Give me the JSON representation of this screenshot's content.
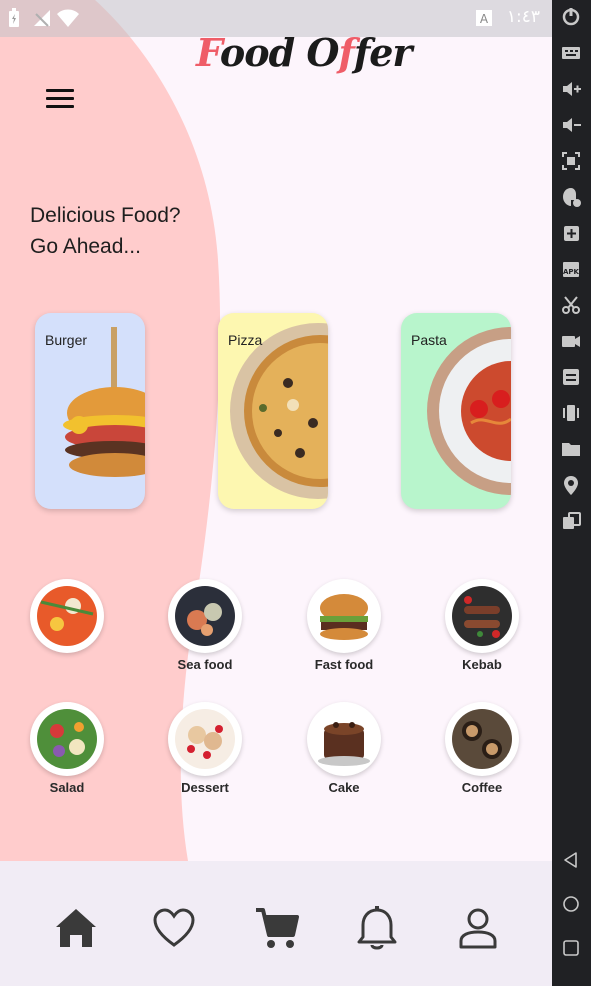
{
  "status_bar": {
    "time": "١:٤٣",
    "icons": [
      "battery-charging-icon",
      "no-signal-icon",
      "wifi-icon",
      "notification-a-icon"
    ]
  },
  "header": {
    "app_title_first": "F",
    "app_title_rest1": "ood O",
    "app_title_f2": "f",
    "app_title_rest2": "fer"
  },
  "menu": {
    "icon": "hamburger-menu-icon"
  },
  "tagline": {
    "line1": "Delicious Food?",
    "line2": "Go Ahead..."
  },
  "featured": [
    {
      "label": "Burger",
      "bg": "#d4e0fb"
    },
    {
      "label": "Pizza",
      "bg": "#fdf7b0"
    },
    {
      "label": "Pasta",
      "bg": "#b8f5cc"
    }
  ],
  "categories": [
    {
      "label": ""
    },
    {
      "label": "Sea food"
    },
    {
      "label": "Fast food"
    },
    {
      "label": "Kebab"
    },
    {
      "label": "Salad"
    },
    {
      "label": "Dessert"
    },
    {
      "label": "Cake"
    },
    {
      "label": "Coffee"
    }
  ],
  "bottom_nav": [
    "home-icon",
    "heart-icon",
    "cart-icon",
    "bell-icon",
    "person-icon"
  ],
  "colors": {
    "accent_pink": "#ffcccc",
    "screen_bg": "#fdf5fc",
    "nav_bg": "#f1ecf5",
    "toolbar_bg": "#202124"
  }
}
